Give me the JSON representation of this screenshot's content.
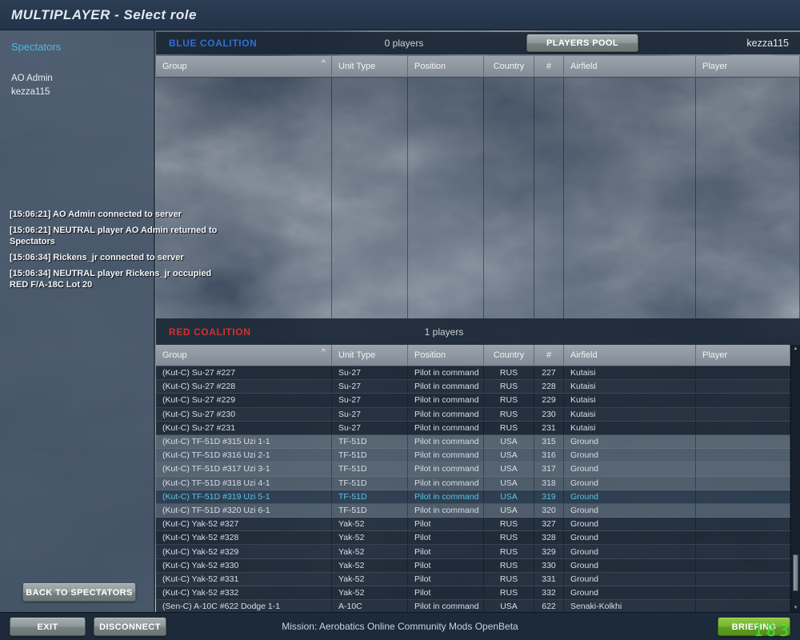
{
  "title_bar": {
    "title": "MULTIPLAYER - Select role"
  },
  "sidebar": {
    "tab": "Spectators",
    "players": [
      "AO Admin",
      "kezza115"
    ],
    "chat_log": [
      "[15:06:21] AO Admin connected to server",
      "[15:06:21] NEUTRAL player AO Admin returned to Spectators",
      "[15:06:34] Rickens_jr connected to server",
      "[15:06:34] NEUTRAL player Rickens_jr occupied RED F/A-18C Lot 20"
    ],
    "back_button": "BACK TO SPECTATORS"
  },
  "top_bar": {
    "blue_label": "BLUE COALITION",
    "blue_players": "0 players",
    "players_pool_button": "PLAYERS POOL",
    "username": "kezza115"
  },
  "columns": [
    "Group",
    "Unit Type",
    "Position",
    "Country",
    "#",
    "Airfield",
    "Player"
  ],
  "red_section": {
    "label": "RED COALITION",
    "players": "1 players"
  },
  "red_rows": [
    {
      "group": "(Kut-C) Su-27 #227",
      "unit": "Su-27",
      "position": "Pilot in command",
      "country": "RUS",
      "num": "227",
      "airfield": "Kutaisi",
      "player": "",
      "shade": "dark"
    },
    {
      "group": "(Kut-C) Su-27 #228",
      "unit": "Su-27",
      "position": "Pilot in command",
      "country": "RUS",
      "num": "228",
      "airfield": "Kutaisi",
      "player": "",
      "shade": "dark"
    },
    {
      "group": "(Kut-C) Su-27 #229",
      "unit": "Su-27",
      "position": "Pilot in command",
      "country": "RUS",
      "num": "229",
      "airfield": "Kutaisi",
      "player": "",
      "shade": "dark"
    },
    {
      "group": "(Kut-C) Su-27 #230",
      "unit": "Su-27",
      "position": "Pilot in command",
      "country": "RUS",
      "num": "230",
      "airfield": "Kutaisi",
      "player": "",
      "shade": "dark"
    },
    {
      "group": "(Kut-C) Su-27 #231",
      "unit": "Su-27",
      "position": "Pilot in command",
      "country": "RUS",
      "num": "231",
      "airfield": "Kutaisi",
      "player": "",
      "shade": "dark"
    },
    {
      "group": "(Kut-C) TF-51D #315 Uzi 1-1",
      "unit": "TF-51D",
      "position": "Pilot in command",
      "country": "USA",
      "num": "315",
      "airfield": "Ground",
      "player": "",
      "shade": "light"
    },
    {
      "group": "(Kut-C) TF-51D #316 Uzi 2-1",
      "unit": "TF-51D",
      "position": "Pilot in command",
      "country": "USA",
      "num": "316",
      "airfield": "Ground",
      "player": "",
      "shade": "light"
    },
    {
      "group": "(Kut-C) TF-51D #317 Uzi 3-1",
      "unit": "TF-51D",
      "position": "Pilot in command",
      "country": "USA",
      "num": "317",
      "airfield": "Ground",
      "player": "",
      "shade": "light"
    },
    {
      "group": "(Kut-C) TF-51D #318 Uzi 4-1",
      "unit": "TF-51D",
      "position": "Pilot in command",
      "country": "USA",
      "num": "318",
      "airfield": "Ground",
      "player": "",
      "shade": "light"
    },
    {
      "group": "(Kut-C) TF-51D #319 Uzi 5-1",
      "unit": "TF-51D",
      "position": "Pilot in command",
      "country": "USA",
      "num": "319",
      "airfield": "Ground",
      "player": "",
      "shade": "selected"
    },
    {
      "group": "(Kut-C) TF-51D #320 Uzi 6-1",
      "unit": "TF-51D",
      "position": "Pilot in command",
      "country": "USA",
      "num": "320",
      "airfield": "Ground",
      "player": "",
      "shade": "light"
    },
    {
      "group": "(Kut-C) Yak-52 #327",
      "unit": "Yak-52",
      "position": "Pilot",
      "country": "RUS",
      "num": "327",
      "airfield": "Ground",
      "player": "",
      "shade": "dark"
    },
    {
      "group": "(Kut-C) Yak-52 #328",
      "unit": "Yak-52",
      "position": "Pilot",
      "country": "RUS",
      "num": "328",
      "airfield": "Ground",
      "player": "",
      "shade": "dark"
    },
    {
      "group": "(Kut-C) Yak-52 #329",
      "unit": "Yak-52",
      "position": "Pilot",
      "country": "RUS",
      "num": "329",
      "airfield": "Ground",
      "player": "",
      "shade": "dark"
    },
    {
      "group": "(Kut-C) Yak-52 #330",
      "unit": "Yak-52",
      "position": "Pilot",
      "country": "RUS",
      "num": "330",
      "airfield": "Ground",
      "player": "",
      "shade": "dark"
    },
    {
      "group": "(Kut-C) Yak-52 #331",
      "unit": "Yak-52",
      "position": "Pilot",
      "country": "RUS",
      "num": "331",
      "airfield": "Ground",
      "player": "",
      "shade": "dark"
    },
    {
      "group": "(Kut-C) Yak-52 #332",
      "unit": "Yak-52",
      "position": "Pilot",
      "country": "RUS",
      "num": "332",
      "airfield": "Ground",
      "player": "",
      "shade": "dark"
    },
    {
      "group": "(Sen-C) A-10C #622 Dodge 1-1",
      "unit": "A-10C",
      "position": "Pilot in command",
      "country": "USA",
      "num": "622",
      "airfield": "Senaki-Kolkhi",
      "player": "",
      "shade": "dark"
    }
  ],
  "bottom_bar": {
    "exit": "EXIT",
    "disconnect": "DISCONNECT",
    "mission": "Mission: Aerobatics Online Community Mods OpenBeta",
    "briefing": "BRIEFING",
    "fps": "183"
  },
  "icons": {
    "sort_asc": "^",
    "scroll_up": "▲",
    "scroll_down": "▼"
  },
  "colors": {
    "blue_accent": "#2e6fd8",
    "red_accent": "#d33030",
    "selected_cyan": "#58c6ea",
    "spectators_cyan": "#49b9e8",
    "briefing_green": "#6aa92c",
    "fps_green": "#49e93f"
  }
}
